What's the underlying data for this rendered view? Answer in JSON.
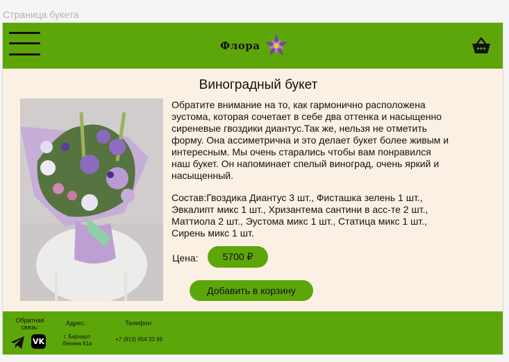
{
  "frame_label": "Страница букета",
  "header": {
    "logo_text": "Флора",
    "colors": {
      "brand_green": "#5da60a",
      "flower_purple": "#7b3fa3",
      "flower_center": "#f2d31b"
    },
    "icons": {
      "menu": "burger-menu-icon",
      "cart": "shopping-basket-icon",
      "logo": "flower-icon"
    }
  },
  "product": {
    "title": "Виноградный букет",
    "description": "Обратите внимание на то, как гармонично расположена эустома, которая сочетает в себе два оттенка и насыщенно сиреневые гвоздики диантус.Так же, нельзя не отметить форму. Она ассиметрична и это делает букет более живым и интересным. Мы очень старались чтобы вам понравился наш букет. Он напоминает спелый виноград, очень яркий и насыщенный.",
    "composition": "Состав:Гвоздика Диантус 3 шт., Фисташка зелень 1 шт., Эвкалипт микс 1 шт., Хризантема сантини в асс-те 2 шт., Маттиола 2 шт., Эустома микс 1 шт., Статица микс 1 шт., Сирень микс 1 шт.",
    "price_label": "Цена:",
    "price": "5700 ₽",
    "add_to_cart": "Добавить в корзину"
  },
  "footer": {
    "feedback_label": "Обратная связь:",
    "address_label": "Адрес:",
    "address_line1": "г. Барнаул",
    "address_line2": "Ленина 61а",
    "phone_label": "Телефон:",
    "phone": "+7 (913) 654 33 99",
    "vk_text": "VK",
    "icons": {
      "telegram": "telegram-icon",
      "vk": "vk-icon"
    }
  }
}
